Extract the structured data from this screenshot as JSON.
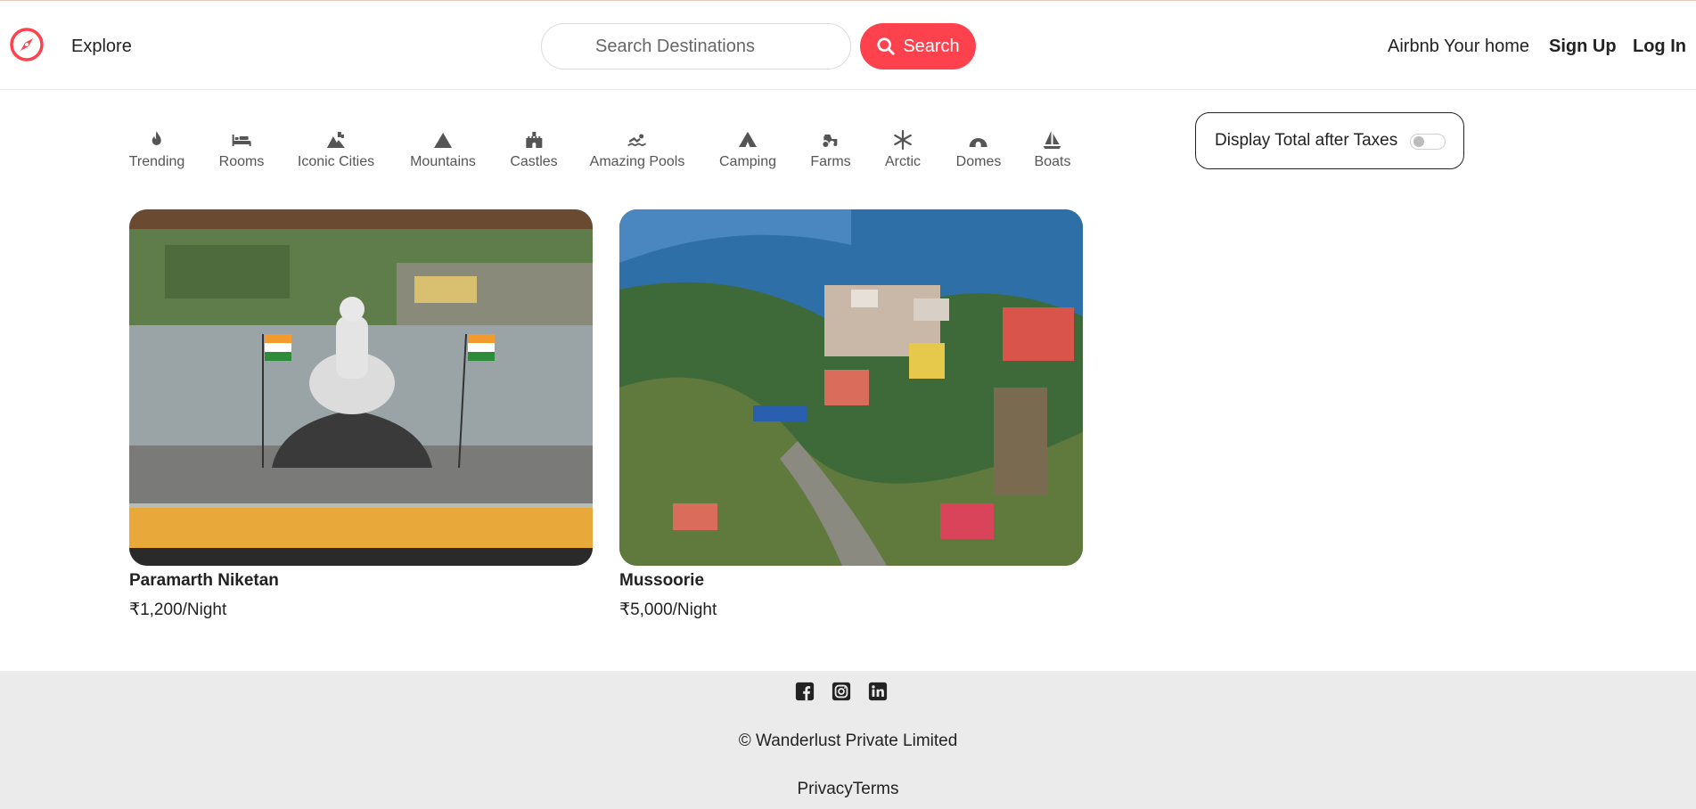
{
  "navbar": {
    "explore_label": "Explore",
    "search_placeholder": "Search Destinations",
    "search_button_label": "Search",
    "home_link": "Airbnb Your home",
    "signup_link": "Sign Up",
    "login_link": "Log In",
    "brand_color": "#fe424d"
  },
  "filters": [
    {
      "label": "Trending",
      "icon": "fire-icon"
    },
    {
      "label": "Rooms",
      "icon": "bed-icon"
    },
    {
      "label": "Iconic Cities",
      "icon": "city-icon"
    },
    {
      "label": "Mountains",
      "icon": "mountain-icon"
    },
    {
      "label": "Castles",
      "icon": "castle-icon"
    },
    {
      "label": "Amazing Pools",
      "icon": "swimmer-icon"
    },
    {
      "label": "Camping",
      "icon": "tent-icon"
    },
    {
      "label": "Farms",
      "icon": "tractor-icon"
    },
    {
      "label": "Arctic",
      "icon": "snowflake-icon"
    },
    {
      "label": "Domes",
      "icon": "igloo-icon"
    },
    {
      "label": "Boats",
      "icon": "sailboat-icon"
    }
  ],
  "tax_toggle": {
    "label": "Display Total after Taxes",
    "enabled": false
  },
  "listings": [
    {
      "title": "Paramarth Niketan",
      "price": "₹1,200/Night"
    },
    {
      "title": "Mussoorie",
      "price": "₹5,000/Night"
    }
  ],
  "footer": {
    "social_icons": [
      "facebook-icon",
      "instagram-icon",
      "linkedin-icon"
    ],
    "copyright": "© Wanderlust Private Limited",
    "privacy_link": "Privacy",
    "terms_link": "Terms"
  }
}
